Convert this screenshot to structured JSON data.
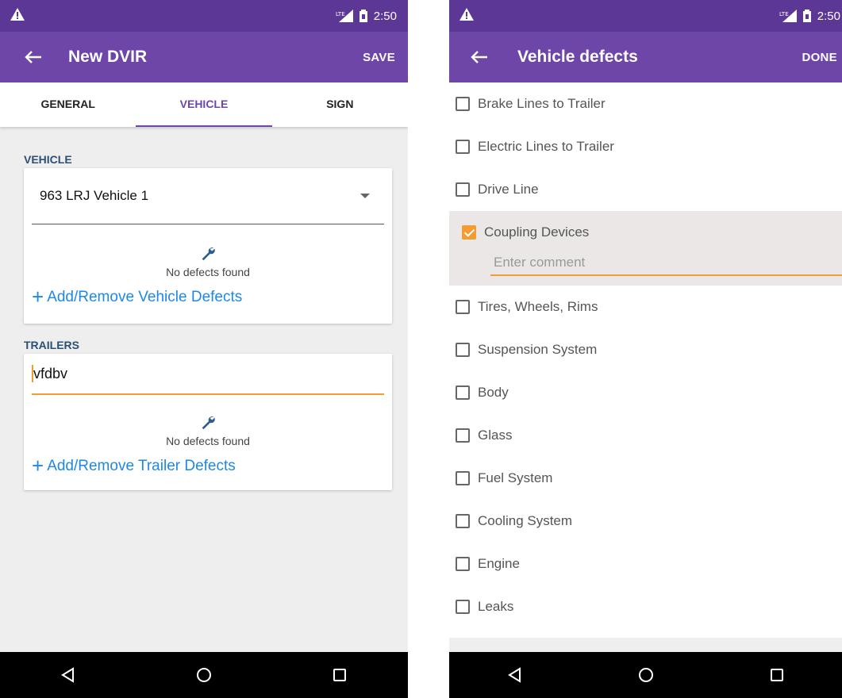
{
  "colors": {
    "primary": "#6d46a8",
    "status": "#5c3796",
    "accent": "#f39c32",
    "link": "#1e88e5",
    "section": "#2c4f74"
  },
  "status": {
    "time": "2:50",
    "signal": "LTE"
  },
  "left": {
    "title": "New DVIR",
    "action": "SAVE",
    "tabs": [
      {
        "label": "GENERAL",
        "active": false
      },
      {
        "label": "VEHICLE",
        "active": true
      },
      {
        "label": "SIGN",
        "active": false
      }
    ],
    "vehicle": {
      "section_label": "VEHICLE",
      "selected": "963 LRJ Vehicle 1",
      "no_defects": "No defects found",
      "add_link": "Add/Remove Vehicle Defects"
    },
    "trailers": {
      "section_label": "TRAILERS",
      "input_value": "vfdbv",
      "no_defects": "No defects found",
      "add_link": "Add/Remove Trailer Defects"
    }
  },
  "right": {
    "title": "Vehicle defects",
    "action": "DONE",
    "items": [
      {
        "label": "Brake Lines to Trailer",
        "checked": false
      },
      {
        "label": "Electric Lines to Trailer",
        "checked": false
      },
      {
        "label": "Drive Line",
        "checked": false
      },
      {
        "label": "Coupling Devices",
        "checked": true,
        "comment_placeholder": "Enter comment"
      },
      {
        "label": "Tires, Wheels, Rims",
        "checked": false
      },
      {
        "label": "Suspension System",
        "checked": false
      },
      {
        "label": "Body",
        "checked": false
      },
      {
        "label": "Glass",
        "checked": false
      },
      {
        "label": "Fuel System",
        "checked": false
      },
      {
        "label": "Cooling System",
        "checked": false
      },
      {
        "label": "Engine",
        "checked": false
      },
      {
        "label": "Leaks",
        "checked": false
      }
    ]
  },
  "icons": {
    "back": "arrow-back-icon",
    "wrench": "wrench-icon",
    "warning": "warning-icon",
    "nav_back": "triangle-back-icon",
    "nav_home": "circle-home-icon",
    "nav_recents": "square-recents-icon"
  }
}
